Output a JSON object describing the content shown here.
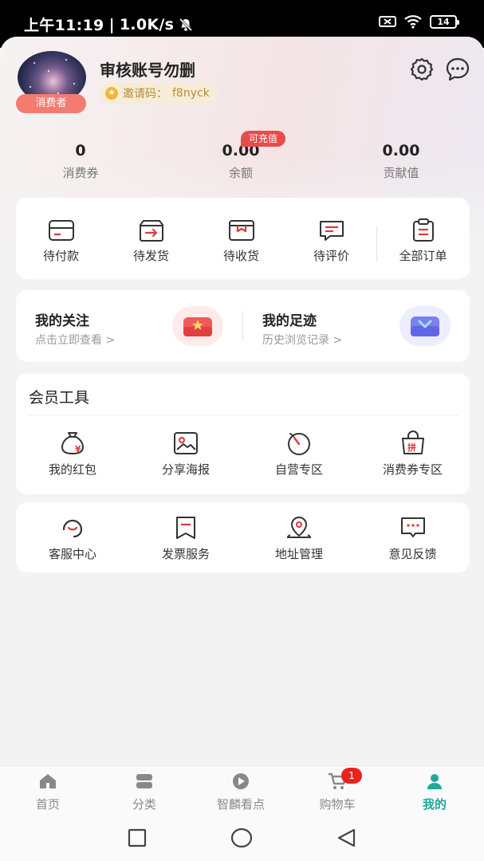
{
  "status_bar": {
    "time": "上午11:19",
    "network_speed": "1.0K/s",
    "battery": "14"
  },
  "profile": {
    "username": "审核账号勿删",
    "role_badge": "消费者",
    "invite_label": "邀请码：",
    "invite_code": "f8nyck"
  },
  "stats": [
    {
      "value": "0",
      "label": "消费券"
    },
    {
      "value": "0.00",
      "label": "余额",
      "tag": "可充值"
    },
    {
      "value": "0.00",
      "label": "贡献值"
    }
  ],
  "orders": [
    {
      "label": "待付款",
      "icon": "wallet-card-icon"
    },
    {
      "label": "待发货",
      "icon": "box-arrow-icon"
    },
    {
      "label": "待收货",
      "icon": "package-icon"
    },
    {
      "label": "待评价",
      "icon": "comment-icon"
    },
    {
      "label": "全部订单",
      "icon": "clipboard-icon"
    }
  ],
  "follow": {
    "left": {
      "title": "我的关注",
      "subtitle": "点击立即查看 >"
    },
    "right": {
      "title": "我的足迹",
      "subtitle": "历史浏览记录 >"
    }
  },
  "member_tools": {
    "title": "会员工具",
    "items": [
      {
        "label": "我的红包",
        "icon": "money-bag-icon"
      },
      {
        "label": "分享海报",
        "icon": "poster-icon"
      },
      {
        "label": "自营专区",
        "icon": "timer-icon"
      },
      {
        "label": "消费券专区",
        "icon": "shopping-bag-icon"
      }
    ]
  },
  "services": [
    {
      "label": "客服中心",
      "icon": "headset-icon"
    },
    {
      "label": "发票服务",
      "icon": "invoice-icon"
    },
    {
      "label": "地址管理",
      "icon": "location-pin-icon"
    },
    {
      "label": "意见反馈",
      "icon": "feedback-icon"
    }
  ],
  "tabbar": {
    "items": [
      {
        "label": "首页",
        "icon": "home-icon"
      },
      {
        "label": "分类",
        "icon": "category-icon"
      },
      {
        "label": "智麟看点",
        "icon": "play-icon"
      },
      {
        "label": "购物车",
        "icon": "cart-icon",
        "badge": "1"
      },
      {
        "label": "我的",
        "icon": "user-icon",
        "active": true
      }
    ]
  },
  "colors": {
    "accent": "#20a79a",
    "badge_red": "#e8231f",
    "role_badge": "#f47b6f",
    "icon_red": "#d93a3a"
  }
}
